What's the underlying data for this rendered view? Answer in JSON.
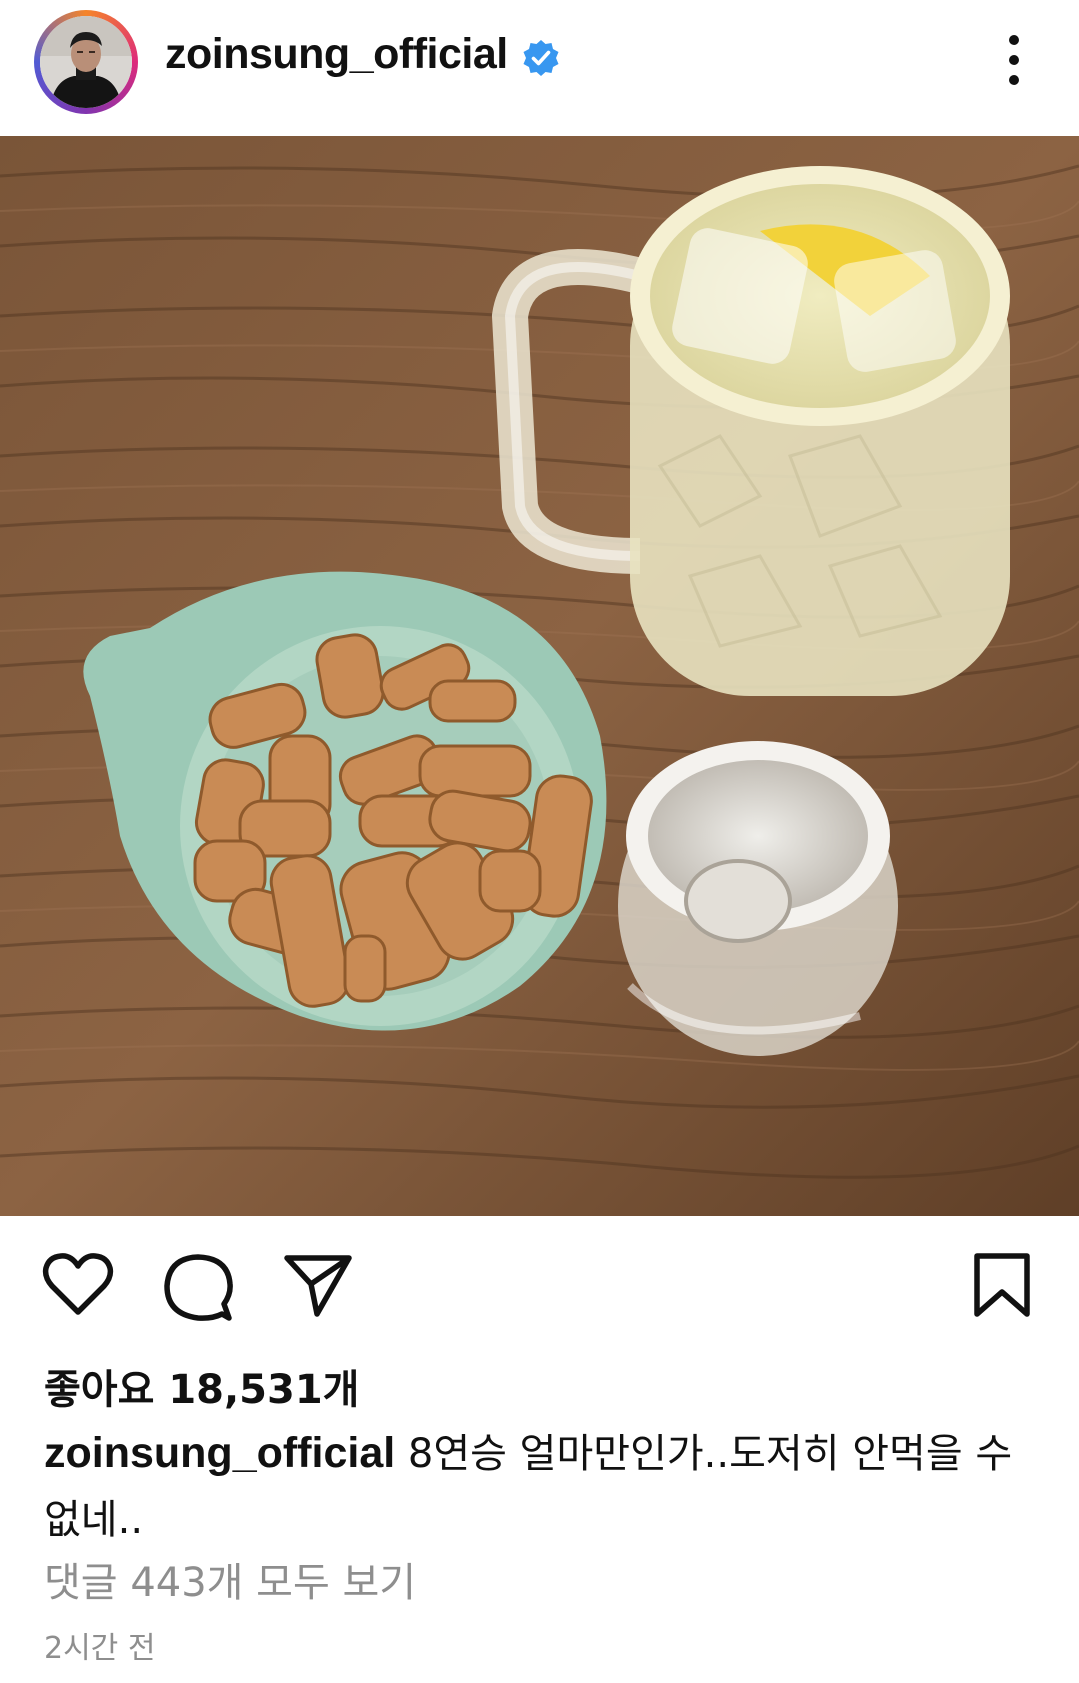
{
  "post": {
    "username": "zoinsung_official",
    "likes_text": "좋아요 18,531개",
    "caption": "8연승 얼마만인가..도저히 안먹을 수 없네..",
    "comments_link": "댓글 443개 모두 보기",
    "time_ago": "2시간 전"
  },
  "icons": {
    "verified": "verified-badge-icon",
    "more": "more-options-icon",
    "like": "heart-icon",
    "comment": "comment-icon",
    "share": "send-icon",
    "save": "bookmark-icon"
  },
  "colors": {
    "verified": "#3897f0",
    "secondary_text": "#8e8e8e"
  }
}
